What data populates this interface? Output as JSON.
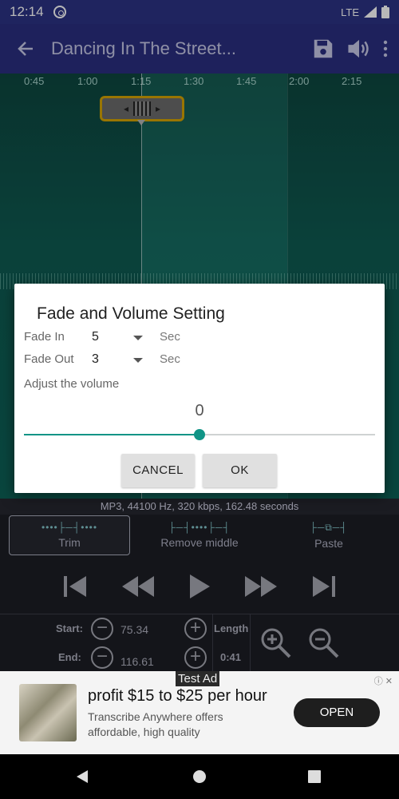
{
  "status_bar": {
    "time": "12:14",
    "network": "LTE"
  },
  "app_bar": {
    "title": "Dancing In The Street..."
  },
  "timeline": {
    "ticks": [
      "0:45",
      "1:00",
      "1:15",
      "1:30",
      "1:45",
      "2:00",
      "2:15"
    ]
  },
  "file_info": "MP3, 44100 Hz, 320 kbps, 162.48 seconds",
  "modes": [
    {
      "label": "Trim",
      "active": true
    },
    {
      "label": "Remove middle",
      "active": false
    },
    {
      "label": "Paste",
      "active": false
    }
  ],
  "range": {
    "start_label": "Start:",
    "start_value": "75.34",
    "end_label": "End:",
    "end_value": "116.61",
    "length_label": "Length",
    "length_value": "0:41"
  },
  "ad": {
    "badge": "Test Ad",
    "headline": "profit $15 to $25 per hour",
    "body": "Transcribe Anywhere offers affordable, high quality",
    "cta": "OPEN"
  },
  "dialog": {
    "title": "Fade and Volume Setting",
    "fade_in_label": "Fade In",
    "fade_in_value": "5",
    "fade_out_label": "Fade Out",
    "fade_out_value": "3",
    "unit": "Sec",
    "adjust_label": "Adjust the volume",
    "volume_value": "0",
    "volume_fraction": 0.5,
    "cancel": "CANCEL",
    "ok": "OK"
  },
  "colors": {
    "accent": "#109486",
    "appbar": "#2c3284",
    "handle_border": "#d4a300"
  }
}
